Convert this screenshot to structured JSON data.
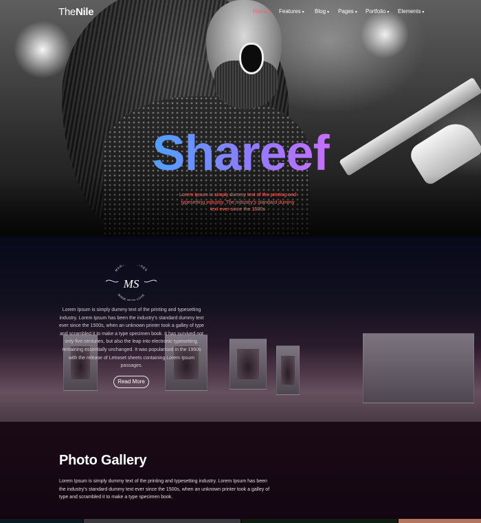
{
  "brand": {
    "logo_light": "The",
    "logo_bold": "Nile"
  },
  "nav": {
    "items": [
      {
        "label": "Home",
        "active": true
      },
      {
        "label": "Features",
        "active": false
      },
      {
        "label": "Blog",
        "active": false
      },
      {
        "label": "Pages",
        "active": false
      },
      {
        "label": "Portfolio",
        "active": false
      },
      {
        "label": "Elements",
        "active": false
      }
    ],
    "caret": "▾"
  },
  "hero": {
    "title": "Shareef",
    "subtitle": "Lorem Ipsum is simply dummy text of the printing and typesetting industry. The industry's standard dummy text ever since the 1500s"
  },
  "about": {
    "signature": {
      "monogram": "MS",
      "top_text": "MARTHA SMITHES",
      "bottom_text": "MADE WITH LOVE"
    },
    "body": "Lorem Ipsum is simply dummy text of the printing and typesetting industry. Lorem Ipsum has been the industry's standard dummy text ever since the 1500s, when an unknown printer took a galley of type and scrambled it to make a type specimen book. It has survived not only five centuries, but also the leap into electronic typesetting, remaining essentially unchanged. It was popularised in the 1960s with the release of Letraset sheets containing Lorem Ipsum passages.",
    "button": "Read More"
  },
  "gallery": {
    "title": "Photo Gallery",
    "body": "Lorem Ipsum is simply dummy text of the printing and typesetting industry. Lorem Ipsum has been the industry's standard dummy text ever since the 1500s, when an unknown printer took a galley of type and scrambled it to make a type specimen book."
  },
  "colors": {
    "accent": "#ff5a70",
    "subtitle": "#ff6b63",
    "title_gradient_start": "#2fd6ff",
    "title_gradient_end": "#ff5ad6",
    "gallery_bg": "#1a0a16"
  }
}
